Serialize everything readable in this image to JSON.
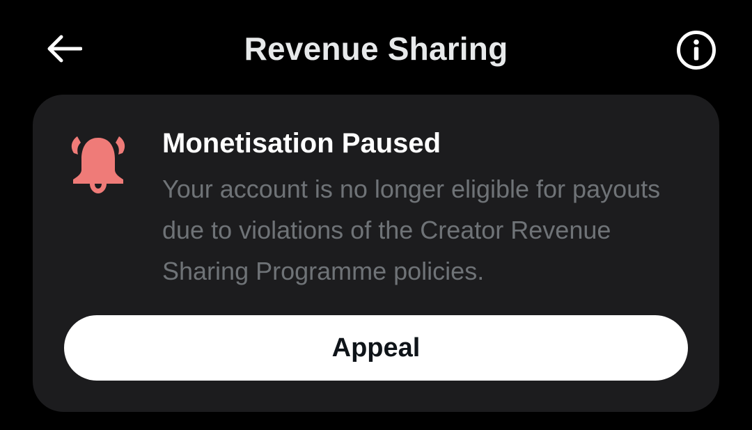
{
  "header": {
    "title": "Revenue Sharing",
    "back_icon": "arrow-left-icon",
    "info_icon": "info-circle-icon"
  },
  "notice": {
    "icon": "bell-ringing-icon",
    "icon_color": "#ef7b78",
    "title": "Monetisation Paused",
    "body": "Your account is no longer eligible for payouts due to violations of the Creator Revenue Sharing Programme policies."
  },
  "actions": {
    "appeal_label": "Appeal"
  },
  "colors": {
    "background": "#000000",
    "card": "#1c1c1e",
    "title_text": "#ffffff",
    "body_text": "#6f7377",
    "button_bg": "#ffffff",
    "button_text": "#0f1419"
  }
}
